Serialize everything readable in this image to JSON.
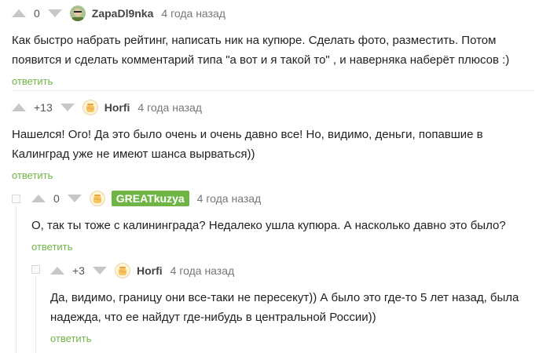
{
  "comments": [
    {
      "rating": "0",
      "author": "ZapaDl9nka",
      "time": "4 года назад",
      "text": "Как быстро набрать рейтинг, написать ник на купюре. Сделать фото, разместить. Потом появится и сделать комментарий типа \"а вот и я такой то\" , и наверняка наберёт плюсов :)",
      "reply": "ответить"
    },
    {
      "rating": "+13",
      "author": "Horfi",
      "time": "4 года назад",
      "text": "Нашелся! Ого! Да это было очень и очень давно все! Но, видимо, деньги, попавшие в Калинград уже не имеют шанса вырваться))",
      "reply": "ответить"
    },
    {
      "rating": "0",
      "author": "GREATkuzya",
      "time": "4 года назад",
      "text": "О, так ты тоже с калининграда? Недалеко ушла купюра. А насколько давно это было?",
      "reply": "ответить"
    },
    {
      "rating": "+3",
      "author": "Horfi",
      "time": "4 года назад",
      "text": "Да, видимо, границу они все-таки не пересекут)) А было это где-то 5 лет назад, была надежда, что ее найдут где-нибудь в центральной России))",
      "reply": "ответить"
    }
  ],
  "colors": {
    "accent": "#6fb545",
    "vote_arrow": "#c7c7c7",
    "author_badge_bg": "#6fb545"
  },
  "icons": {
    "avatar_default": "honey-jar-avatar",
    "avatar_user": "photo-avatar"
  }
}
